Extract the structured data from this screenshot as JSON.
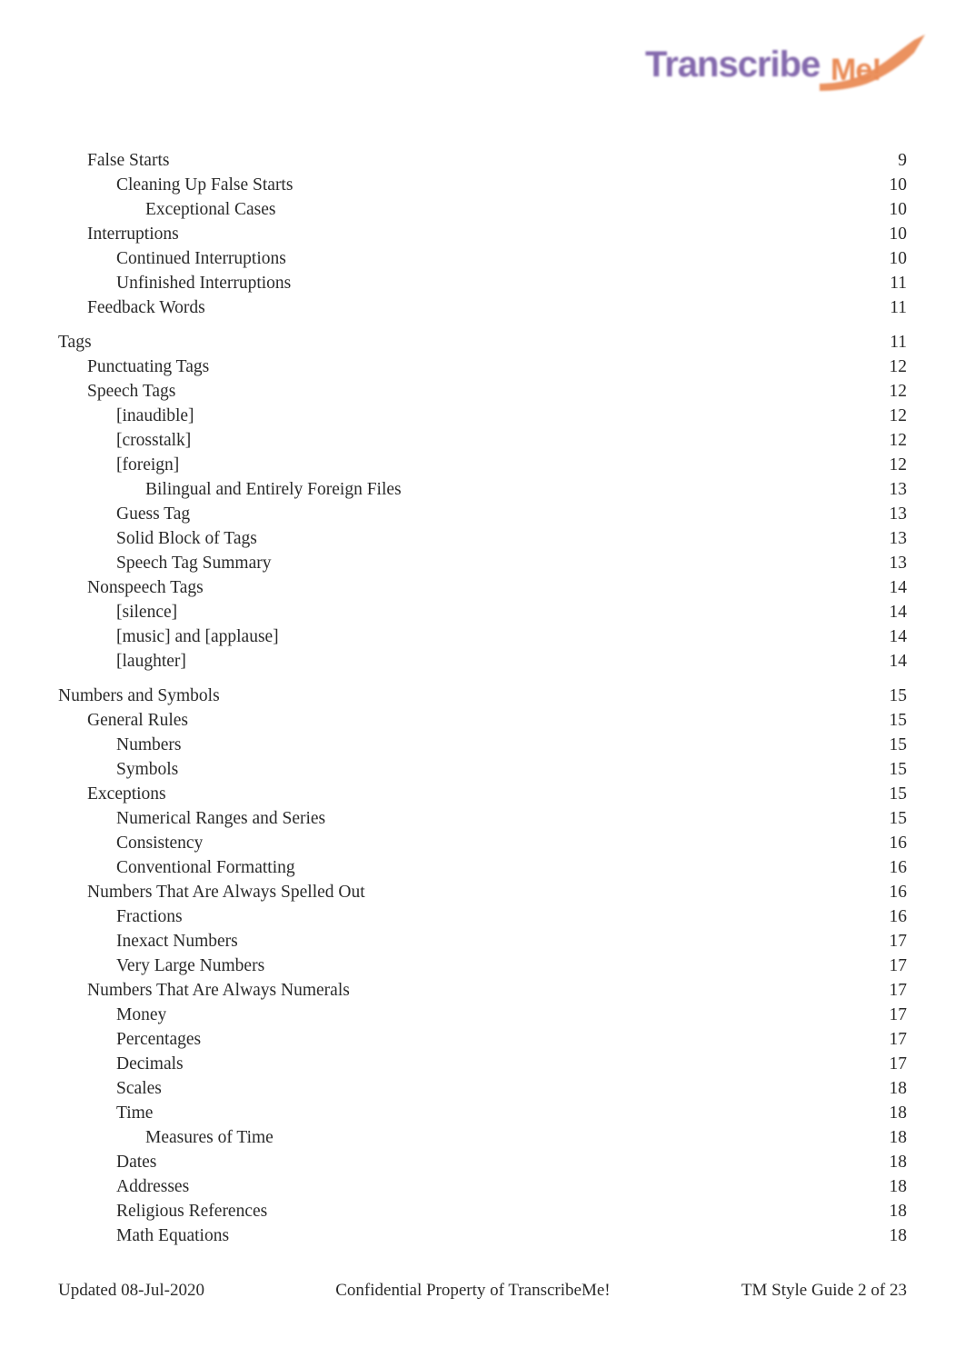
{
  "document": {
    "logo": {
      "icon": "transcribeme-logo",
      "text_primary": "Transcribe",
      "text_secondary": "Me!",
      "color_primary": "#7B5EA7",
      "color_secondary": "#E8834A"
    }
  },
  "toc": {
    "entries": [
      {
        "title": "False Starts",
        "page": "9",
        "level": 1,
        "group_start": false
      },
      {
        "title": "Cleaning Up False Starts",
        "page": "10",
        "level": 2,
        "group_start": false
      },
      {
        "title": "Exceptional Cases",
        "page": "10",
        "level": 3,
        "group_start": false
      },
      {
        "title": "Interruptions",
        "page": "10",
        "level": 1,
        "group_start": false
      },
      {
        "title": "Continued Interruptions",
        "page": "10",
        "level": 2,
        "group_start": false
      },
      {
        "title": "Unfinished Interruptions",
        "page": "11",
        "level": 2,
        "group_start": false
      },
      {
        "title": "Feedback Words",
        "page": "11",
        "level": 1,
        "group_start": false
      },
      {
        "title": "Tags",
        "page": "11",
        "level": 0,
        "group_start": true
      },
      {
        "title": "Punctuating Tags",
        "page": "12",
        "level": 1,
        "group_start": false
      },
      {
        "title": "Speech Tags",
        "page": "12",
        "level": 1,
        "group_start": false
      },
      {
        "title": "[inaudible]",
        "page": "12",
        "level": 2,
        "group_start": false
      },
      {
        "title": "[crosstalk]",
        "page": "12",
        "level": 2,
        "group_start": false
      },
      {
        "title": "[foreign]",
        "page": "12",
        "level": 2,
        "group_start": false
      },
      {
        "title": "Bilingual and Entirely Foreign Files",
        "page": "13",
        "level": 3,
        "group_start": false
      },
      {
        "title": "Guess Tag",
        "page": "13",
        "level": 2,
        "group_start": false
      },
      {
        "title": "Solid Block of Tags",
        "page": "13",
        "level": 2,
        "group_start": false
      },
      {
        "title": "Speech Tag Summary",
        "page": "13",
        "level": 2,
        "group_start": false
      },
      {
        "title": "Nonspeech Tags",
        "page": "14",
        "level": 1,
        "group_start": false
      },
      {
        "title": "[silence]",
        "page": "14",
        "level": 2,
        "group_start": false
      },
      {
        "title": "[music] and [applause]",
        "page": "14",
        "level": 2,
        "group_start": false
      },
      {
        "title": "[laughter]",
        "page": "14",
        "level": 2,
        "group_start": false
      },
      {
        "title": "Numbers and Symbols",
        "page": "15",
        "level": 0,
        "group_start": true
      },
      {
        "title": "General Rules",
        "page": "15",
        "level": 1,
        "group_start": false
      },
      {
        "title": "Numbers",
        "page": "15",
        "level": 2,
        "group_start": false
      },
      {
        "title": "Symbols",
        "page": "15",
        "level": 2,
        "group_start": false
      },
      {
        "title": "Exceptions",
        "page": "15",
        "level": 1,
        "group_start": false
      },
      {
        "title": "Numerical Ranges and Series",
        "page": "15",
        "level": 2,
        "group_start": false
      },
      {
        "title": "Consistency",
        "page": "16",
        "level": 2,
        "group_start": false
      },
      {
        "title": "Conventional Formatting",
        "page": "16",
        "level": 2,
        "group_start": false
      },
      {
        "title": "Numbers That Are Always Spelled Out",
        "page": "16",
        "level": 1,
        "group_start": false
      },
      {
        "title": "Fractions",
        "page": "16",
        "level": 2,
        "group_start": false
      },
      {
        "title": "Inexact Numbers",
        "page": "17",
        "level": 2,
        "group_start": false
      },
      {
        "title": "Very Large Numbers",
        "page": "17",
        "level": 2,
        "group_start": false
      },
      {
        "title": "Numbers That Are Always Numerals",
        "page": "17",
        "level": 1,
        "group_start": false
      },
      {
        "title": "Money",
        "page": "17",
        "level": 2,
        "group_start": false
      },
      {
        "title": "Percentages",
        "page": "17",
        "level": 2,
        "group_start": false
      },
      {
        "title": "Decimals",
        "page": "17",
        "level": 2,
        "group_start": false
      },
      {
        "title": "Scales",
        "page": "18",
        "level": 2,
        "group_start": false
      },
      {
        "title": "Time",
        "page": "18",
        "level": 2,
        "group_start": false
      },
      {
        "title": "Measures of Time",
        "page": "18",
        "level": 3,
        "group_start": false
      },
      {
        "title": "Dates",
        "page": "18",
        "level": 2,
        "group_start": false
      },
      {
        "title": "Addresses",
        "page": "18",
        "level": 2,
        "group_start": false
      },
      {
        "title": "Religious References",
        "page": "18",
        "level": 2,
        "group_start": false
      },
      {
        "title": "Math Equations",
        "page": "18",
        "level": 2,
        "group_start": false
      }
    ]
  },
  "footer": {
    "updated": "Updated 08-Jul-2020",
    "confidential": "Confidential Property of TranscribeMe!",
    "page_label": "TM Style Guide 2 of 23"
  }
}
